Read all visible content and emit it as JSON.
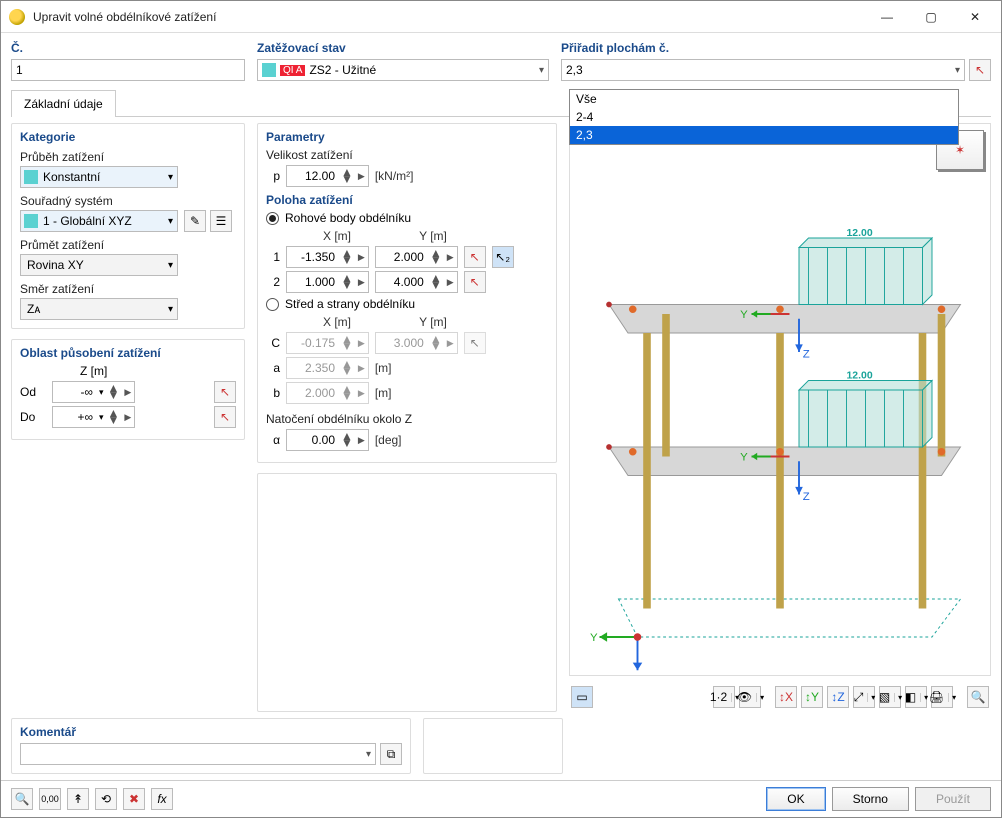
{
  "window": {
    "title": "Upravit volné obdélníkové zatížení"
  },
  "header": {
    "number_label": "Č.",
    "number_value": "1",
    "loadcase_label": "Zatěžovací stav",
    "loadcase_tag": "QI A",
    "loadcase_value": "ZS2 - Užitné",
    "assign_label": "Přiřadit plochám č.",
    "assign_value": "2,3",
    "assign_options": {
      "0": "Vše",
      "1": "2-4",
      "2": "2,3"
    }
  },
  "tabs": {
    "basic": "Základní údaje"
  },
  "category": {
    "title": "Kategorie",
    "course_label": "Průběh zatížení",
    "course_value": "Konstantní",
    "coord_label": "Souřadný systém",
    "coord_value": "1 - Globální XYZ",
    "proj_label": "Průmět zatížení",
    "proj_value": "Rovina XY",
    "dir_label": "Směr zatížení",
    "dir_value": "Zᴀ"
  },
  "params": {
    "title": "Parametry",
    "mag_label": "Velikost zatížení",
    "p_sym": "p",
    "p_value": "12.00",
    "p_unit": "[kN/m²]",
    "pos_title": "Poloha zatížení",
    "corner_label": "Rohové body obdélníku",
    "center_label": "Střed a strany obdélníku",
    "x_head": "X [m]",
    "y_head": "Y [m]",
    "r1_label": "1",
    "r1_x": "-1.350",
    "r1_y": "2.000",
    "r2_label": "2",
    "r2_x": "1.000",
    "r2_y": "4.000",
    "c_label": "C",
    "c_x": "-0.175",
    "c_y": "3.000",
    "a_label": "a",
    "a_val": "2.350",
    "b_label": "b",
    "b_val": "2.000",
    "m_unit": "[m]",
    "rot_label": "Natočení obdélníku okolo Z",
    "alpha_sym": "α",
    "alpha_val": "0.00",
    "alpha_unit": "[deg]"
  },
  "range": {
    "title": "Oblast působení zatížení",
    "z_head": "Z [m]",
    "from_label": "Od",
    "from_val": "-∞",
    "to_label": "Do",
    "to_val": "+∞"
  },
  "comment": {
    "title": "Komentář"
  },
  "viewer": {
    "load_top": "12.00",
    "load_mid": "12.00",
    "axis_x_label": "Y",
    "axis_z_label": "Z",
    "axes_icon_mark": "✶"
  },
  "footer": {
    "ok": "OK",
    "cancel": "Storno",
    "apply": "Použít"
  }
}
